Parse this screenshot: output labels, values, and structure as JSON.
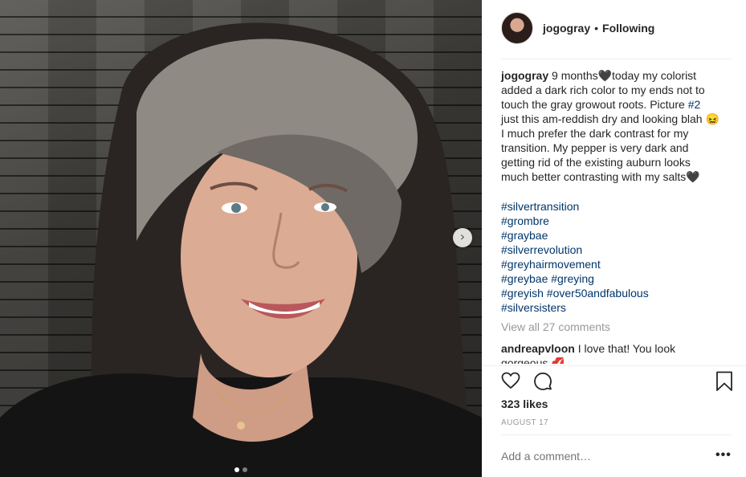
{
  "post": {
    "username": "jogogray",
    "separator": "•",
    "follow_status": "Following",
    "caption_username": "jogogray",
    "caption_lines": [
      "9 months🖤today my colorist",
      "added a dark rich color to my ends not to",
      "touch the gray growout roots. Picture #2",
      "just this am-reddish dry and looking blah 😖",
      "I much prefer the dark contrast for my",
      "transition. My pepper is very dark and",
      "getting rid of the existing auburn looks",
      "much better contrasting with my salts🖤"
    ],
    "hashtags": [
      "#silvertransition",
      "#grombre",
      "#graybae",
      "#silverrevolution",
      "#greyhairmovement",
      "#greybae #greying",
      "#greyish #over50andfabulous",
      "#silversisters"
    ],
    "view_comments": "View all 27 comments",
    "comment": {
      "username": "andreapvloon",
      "text": "I love that! You look gorgeous 💋"
    },
    "likes": "323 likes",
    "date": "AUGUST 17",
    "add_comment_placeholder": "Add a comment…",
    "more_label": "•••"
  },
  "icons": {
    "like": "heart-icon",
    "comment": "comment-bubble-icon",
    "save": "bookmark-icon",
    "next": "chevron-right-icon"
  },
  "carousel": {
    "slides": 2,
    "active": 1
  },
  "colors": {
    "hashtag": "#003569",
    "muted": "#999999",
    "text": "#262626"
  }
}
